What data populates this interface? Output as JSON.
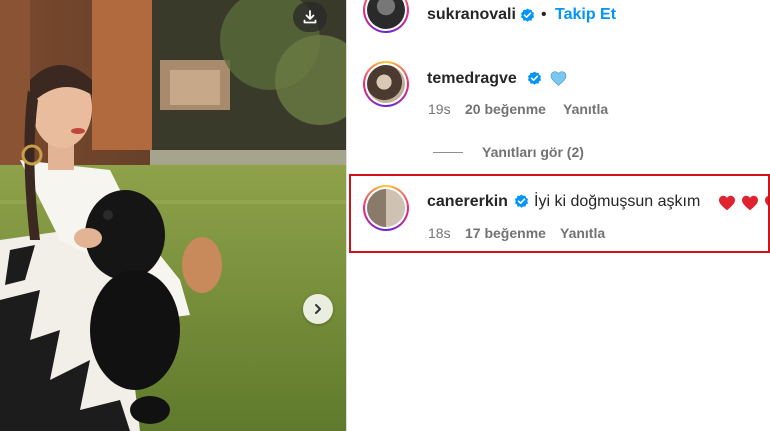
{
  "post": {
    "author": {
      "username": "sukranovali",
      "verified": true,
      "follow_label": "Takip Et",
      "separator": "•"
    },
    "media": {
      "download_icon": "download-icon",
      "next_icon": "chevron-right-icon"
    }
  },
  "comments": [
    {
      "username": "temedragve",
      "verified": true,
      "text": "",
      "emoji": [
        "light-blue-heart"
      ],
      "time": "19s",
      "likes": "20 beğenme",
      "reply_label": "Yanıtla"
    },
    {
      "username": "canererkin",
      "verified": true,
      "text": "İyi ki doğmuşsun aşkım",
      "emoji": [
        "red-heart",
        "red-heart",
        "red-heart"
      ],
      "time": "18s",
      "likes": "17 beğenme",
      "reply_label": "Yanıtla",
      "highlighted": true
    }
  ],
  "view_replies": {
    "label": "Yanıtları gör (2)"
  },
  "colors": {
    "link": "#0095f6",
    "verified": "#0095f6",
    "highlight": "#d0121b",
    "heart_red": "#e0232e",
    "heart_blue": "#7cc7ee"
  }
}
